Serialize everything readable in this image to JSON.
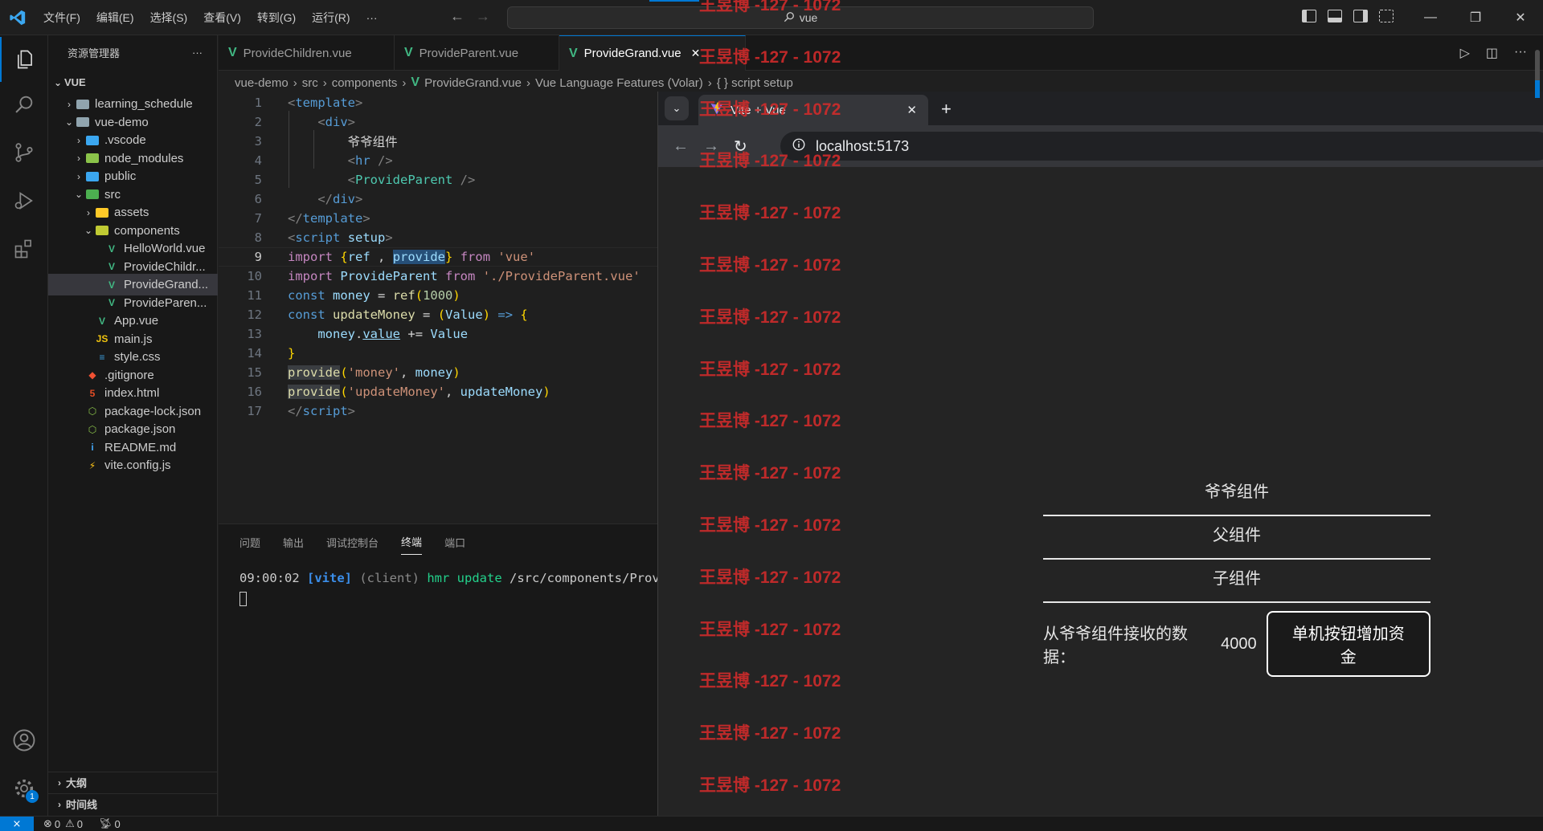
{
  "titlebar": {
    "menu": [
      "文件(F)",
      "编辑(E)",
      "选择(S)",
      "查看(V)",
      "转到(G)",
      "运行(R)",
      "···"
    ],
    "search": "vue"
  },
  "sidebar": {
    "title": "资源管理器",
    "more": "···",
    "root": "VUE",
    "tree": [
      {
        "label": "learning_schedule",
        "depth": 1,
        "kind": "folder",
        "expanded": false
      },
      {
        "label": "vue-demo",
        "depth": 1,
        "kind": "folder",
        "expanded": true
      },
      {
        "label": ".vscode",
        "depth": 2,
        "kind": "folder-vscode",
        "expanded": false
      },
      {
        "label": "node_modules",
        "depth": 2,
        "kind": "folder-node",
        "expanded": false
      },
      {
        "label": "public",
        "depth": 2,
        "kind": "folder-public",
        "expanded": false
      },
      {
        "label": "src",
        "depth": 2,
        "kind": "folder-src",
        "expanded": true
      },
      {
        "label": "assets",
        "depth": 3,
        "kind": "folder-assets",
        "expanded": false
      },
      {
        "label": "components",
        "depth": 3,
        "kind": "folder-components",
        "expanded": true
      },
      {
        "label": "HelloWorld.vue",
        "depth": 4,
        "kind": "vue"
      },
      {
        "label": "ProvideChildr...",
        "depth": 4,
        "kind": "vue"
      },
      {
        "label": "ProvideGrand...",
        "depth": 4,
        "kind": "vue",
        "selected": true
      },
      {
        "label": "ProvideParen...",
        "depth": 4,
        "kind": "vue"
      },
      {
        "label": "App.vue",
        "depth": 3,
        "kind": "vue"
      },
      {
        "label": "main.js",
        "depth": 3,
        "kind": "js"
      },
      {
        "label": "style.css",
        "depth": 3,
        "kind": "css"
      },
      {
        "label": ".gitignore",
        "depth": 2,
        "kind": "git"
      },
      {
        "label": "index.html",
        "depth": 2,
        "kind": "html"
      },
      {
        "label": "package-lock.json",
        "depth": 2,
        "kind": "json"
      },
      {
        "label": "package.json",
        "depth": 2,
        "kind": "json"
      },
      {
        "label": "README.md",
        "depth": 2,
        "kind": "info"
      },
      {
        "label": "vite.config.js",
        "depth": 2,
        "kind": "vite"
      }
    ],
    "outline": "大纲",
    "timeline": "时间线"
  },
  "tabs": [
    {
      "label": "ProvideChildren.vue",
      "active": false
    },
    {
      "label": "ProvideParent.vue",
      "active": false
    },
    {
      "label": "ProvideGrand.vue",
      "active": true
    }
  ],
  "breadcrumb": [
    "vue-demo",
    "src",
    "components",
    "ProvideGrand.vue",
    "Vue Language Features (Volar)",
    "{ } script setup"
  ],
  "code": {
    "current_line": 9,
    "line_numbers": [
      "1",
      "2",
      "3",
      "4",
      "5",
      "6",
      "7",
      "8",
      "9",
      "10",
      "11",
      "12",
      "13",
      "14",
      "15",
      "16",
      "17"
    ],
    "component_text": "爷爷组件"
  },
  "panel": {
    "tabs": [
      "问题",
      "输出",
      "调试控制台",
      "终端",
      "端口"
    ],
    "active_tab": "终端",
    "terminal_time": "09:00:02",
    "terminal_tag": "[vite]",
    "terminal_client": "(client)",
    "terminal_hmr": "hmr update",
    "terminal_path": "/src/components/Provic"
  },
  "statusbar": {
    "errors": "0",
    "warnings": "0",
    "ports": "0"
  },
  "browser": {
    "tab_title": "Vite + Vue",
    "url": "localhost:5173",
    "grand_title": "爷爷组件",
    "parent_title": "父组件",
    "child_title": "子组件",
    "receive_label": "从爷爷组件接收的数据：",
    "money": "4000",
    "button_label": "单机按钮增加资金"
  },
  "watermark": "王昱博 -127 - 1072",
  "colors": {
    "accent": "#0078d4",
    "watermark": "#d42b2b",
    "vue": "#41b883"
  }
}
